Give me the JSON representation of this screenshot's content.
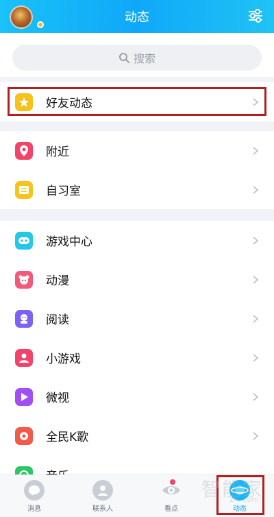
{
  "header": {
    "title": "动态"
  },
  "search": {
    "placeholder": "搜索"
  },
  "friends_feed": {
    "label": "好友动态",
    "icon": "star-icon",
    "color": "#f5c21b"
  },
  "group1": [
    {
      "label": "附近",
      "icon": "location-pin-icon",
      "color": "#f0446a"
    },
    {
      "label": "自习室",
      "icon": "study-room-icon",
      "color": "#f6c41c"
    }
  ],
  "group2": [
    {
      "label": "游戏中心",
      "icon": "gamepad-icon",
      "color": "#25c7e8"
    },
    {
      "label": "动漫",
      "icon": "panda-icon",
      "color": "#f25a7a"
    },
    {
      "label": "阅读",
      "icon": "reader-icon",
      "color": "#7c62f2"
    },
    {
      "label": "小游戏",
      "icon": "mini-game-icon",
      "color": "#f0446a"
    },
    {
      "label": "微视",
      "icon": "play-icon",
      "color": "#a14ff2"
    },
    {
      "label": "全民K歌",
      "icon": "karaoke-icon",
      "color": "#f25a4a"
    },
    {
      "label": "音乐",
      "icon": "music-icon",
      "color": "#2dc46a"
    }
  ],
  "tabs": [
    {
      "label": "消息",
      "icon": "message-icon"
    },
    {
      "label": "联系人",
      "icon": "contacts-icon"
    },
    {
      "label": "看点",
      "icon": "eye-icon",
      "has_dot": true
    },
    {
      "label": "动态",
      "icon": "planet-icon",
      "active": true
    }
  ],
  "watermark": {
    "text": "智能家",
    "url": "zn. com"
  }
}
